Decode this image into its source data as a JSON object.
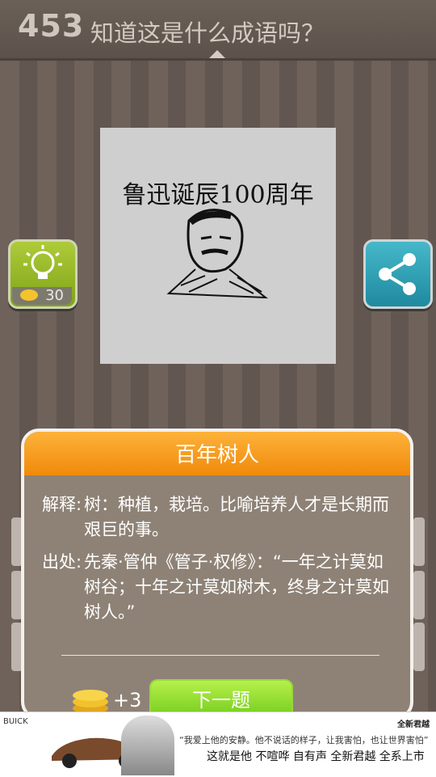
{
  "header": {
    "level": "453",
    "question": "知道这是什么成语吗？"
  },
  "puzzle": {
    "caption": "鲁迅诞辰100周年"
  },
  "hint": {
    "cost": "30"
  },
  "card": {
    "answer": "百年树人",
    "explain_label": "解释:",
    "explain_text": "树：种植，栽培。比喻培养人才是长期而艰巨的事。",
    "source_label": "出处:",
    "source_text": "先秦·管仲《管子·权修》：“一年之计莫如树谷；十年之计莫如树木，终身之计莫如树人。”",
    "reward": "+3",
    "next_label": "下一题"
  },
  "ad": {
    "logo": "BUICK",
    "brand": "全新君越",
    "quote": "“我爱上他的安静。他不说话的样子，让我害怕，也让世界害怕”",
    "tagline": "这就是他 不喧哗 自有声     全新君越 全系上市"
  },
  "colors": {
    "accent_orange": "#f59a1a",
    "next_green": "#7fd321",
    "hint_green": "#98bb2a",
    "share_blue": "#33a3b6"
  }
}
